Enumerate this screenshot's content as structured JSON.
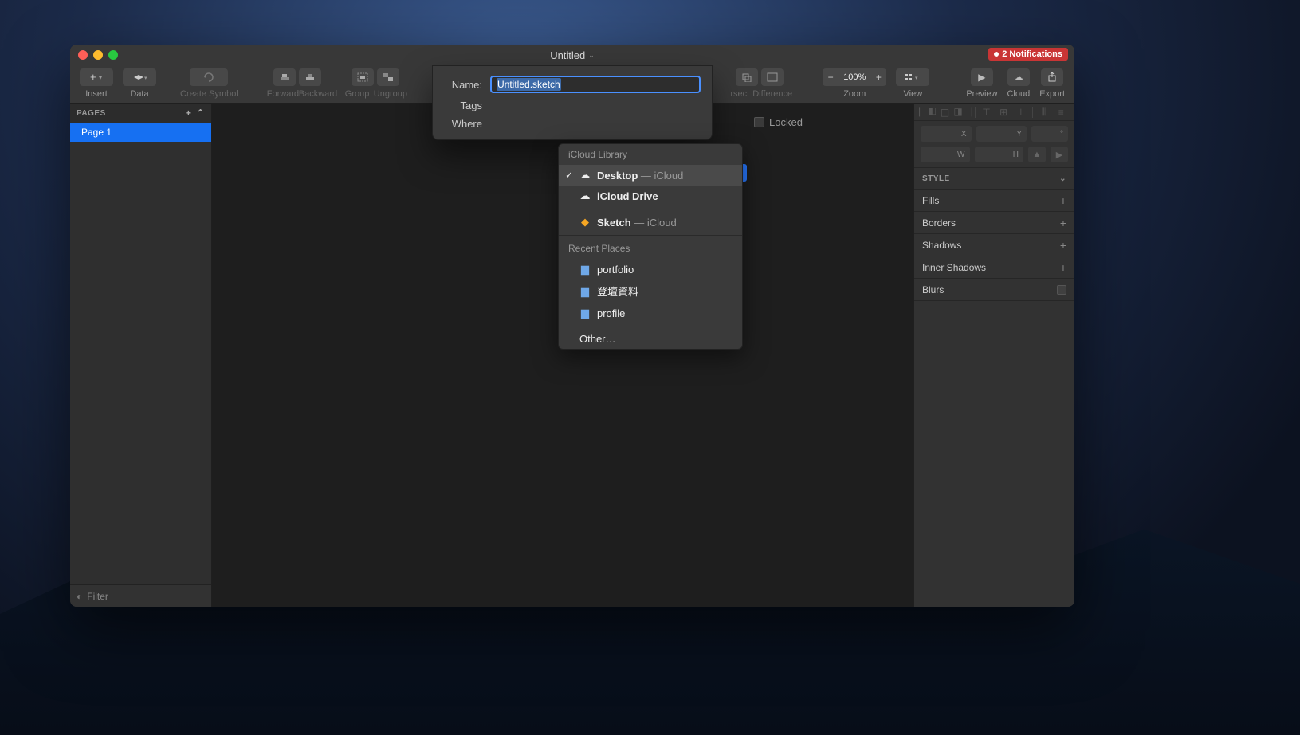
{
  "window": {
    "title": "Untitled",
    "notification_count": "2 Notifications"
  },
  "toolbar": {
    "insert": "Insert",
    "data": "Data",
    "create_symbol": "Create Symbol",
    "forward": "Forward",
    "backward": "Backward",
    "group": "Group",
    "ungroup": "Ungroup",
    "intersect": "rsect",
    "difference": "Difference",
    "zoom_label": "Zoom",
    "zoom_value": "100%",
    "view": "View",
    "preview": "Preview",
    "cloud": "Cloud",
    "export": "Export"
  },
  "sidebar": {
    "pages_label": "PAGES",
    "page_items": [
      "Page 1"
    ],
    "filter_label": "Filter"
  },
  "inspector": {
    "coords": {
      "x": "X",
      "y": "Y",
      "deg": "°",
      "w": "W",
      "h": "H"
    },
    "style_label": "STYLE",
    "items": [
      "Fills",
      "Borders",
      "Shadows",
      "Inner Shadows",
      "Blurs"
    ]
  },
  "save_sheet": {
    "name_label": "Name:",
    "name_value": "Untitled.sketch",
    "tags_label": "Tags",
    "where_label": "Where",
    "locked_label": "Locked"
  },
  "dropdown": {
    "section1_header": "iCloud Library",
    "desktop": "Desktop",
    "desktop_suffix": " — iCloud",
    "icloud_drive": "iCloud Drive",
    "sketch": "Sketch",
    "sketch_suffix": " — iCloud",
    "recent_header": "Recent Places",
    "recent": [
      "portfolio",
      "登壇資料",
      "profile"
    ],
    "other": "Other…"
  }
}
